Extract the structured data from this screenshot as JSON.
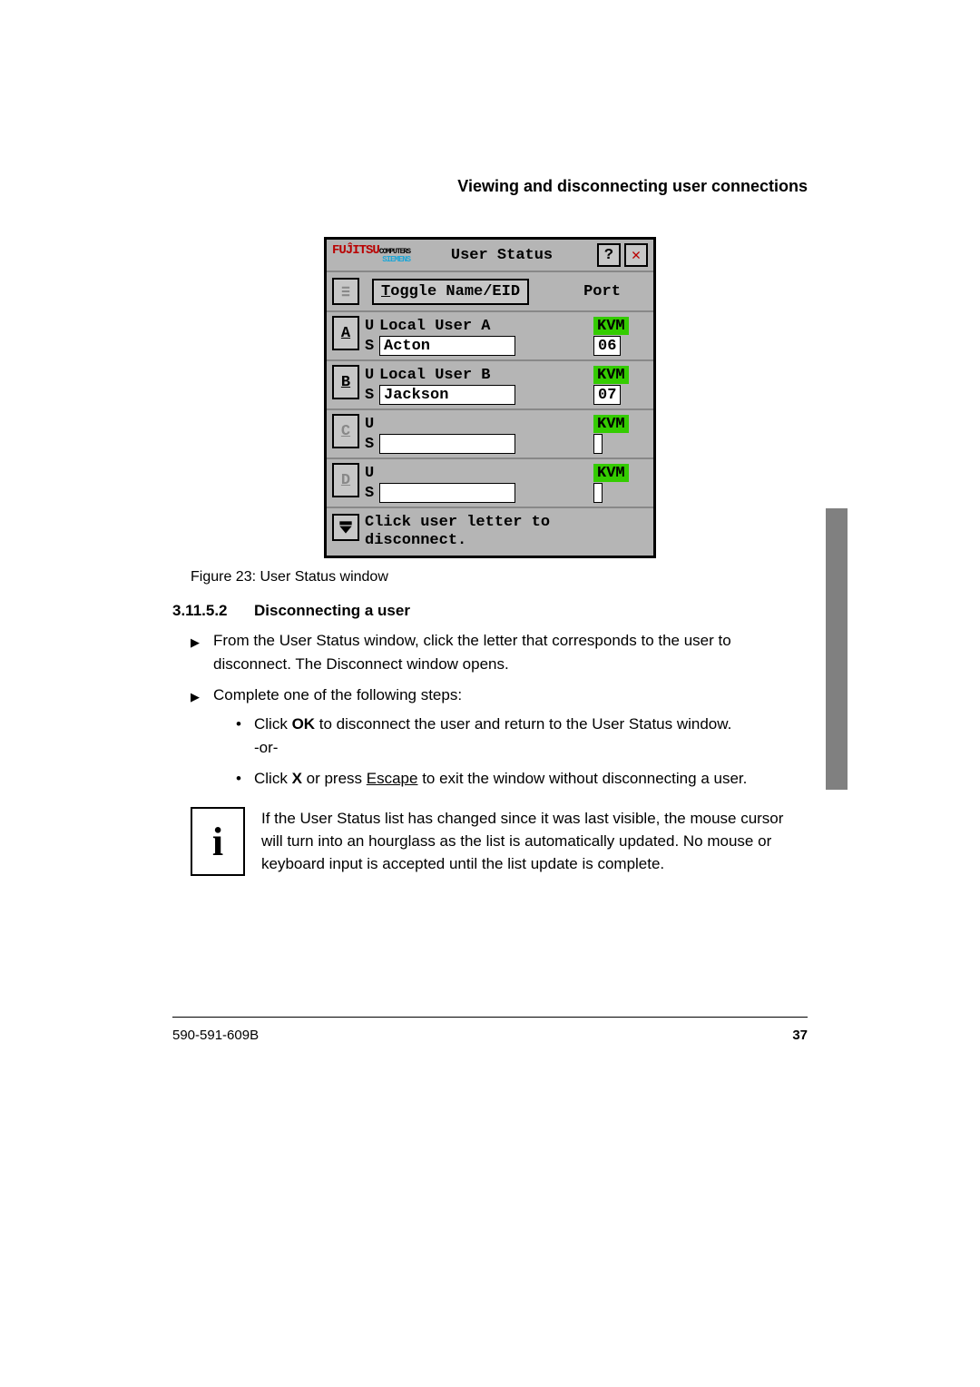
{
  "header": {
    "section": "Viewing and disconnecting user connections"
  },
  "oscar": {
    "title": "User Status",
    "toggle": "Toggle Name/EID",
    "port_header": "Port",
    "help": "?",
    "close": "✕",
    "toggle_hotkey_prefix": "T",
    "toggle_rest": "oggle Name/EID",
    "rows": [
      {
        "letter": "A",
        "enabled": true,
        "u_name": "Local User A",
        "s_name": "Acton",
        "u_port": "KVM",
        "s_port": "06"
      },
      {
        "letter": "B",
        "enabled": true,
        "u_name": "Local User B",
        "s_name": "Jackson",
        "u_port": "KVM",
        "s_port": "07"
      },
      {
        "letter": "C",
        "enabled": false,
        "u_name": "",
        "s_name": "",
        "u_port": "KVM",
        "s_port": ""
      },
      {
        "letter": "D",
        "enabled": false,
        "u_name": "",
        "s_name": "",
        "u_port": "KVM",
        "s_port": ""
      }
    ],
    "hint1": "Click user letter to",
    "hint2": "disconnect."
  },
  "caption": "Figure 23: User Status window",
  "subheading": {
    "num": "3.11.5.2",
    "text": "Disconnecting a user"
  },
  "steps": {
    "s1": "From the User Status window, click the letter that corresponds to the user to disconnect. The Disconnect window opens.",
    "s2": "Complete one of the following steps:",
    "s2a_pre": "Click ",
    "s2a_bold": "OK",
    "s2a_post": " to disconnect the user and return to the User Status window.",
    "or": "-or-",
    "s2b_pre": "Click ",
    "s2b_bold": "X",
    "s2b_mid": " or press ",
    "s2b_ul": "Escape",
    "s2b_post": " to exit the window without disconnecting a user."
  },
  "note": "If the User Status list has changed since it was last visible, the mouse cursor will turn into an hourglass as the list is automatically updated. No mouse or keyboard input is accepted until the list update is complete.",
  "note_icon": "i",
  "footer": {
    "left": "590-591-609B",
    "right": "37"
  }
}
